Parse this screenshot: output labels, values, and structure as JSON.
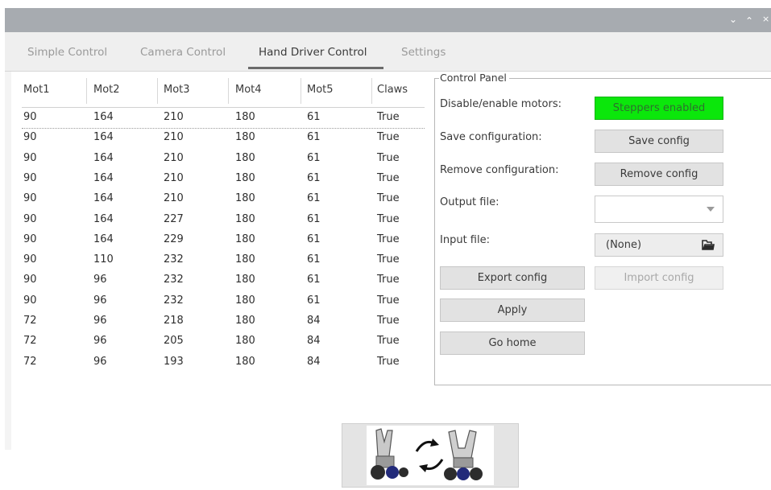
{
  "window": {
    "buttons": [
      "chevron-down-icon",
      "chevron-up-icon",
      "close-icon"
    ]
  },
  "tabs": [
    {
      "label": "Simple Control",
      "active": false
    },
    {
      "label": "Camera Control",
      "active": false
    },
    {
      "label": "Hand Driver Control",
      "active": true
    },
    {
      "label": "Settings",
      "active": false
    }
  ],
  "table": {
    "headers": [
      "Mot1",
      "Mot2",
      "Mot3",
      "Mot4",
      "Mot5",
      "Claws"
    ],
    "rows": [
      [
        "90",
        "164",
        "210",
        "180",
        "61",
        "True"
      ],
      [
        "90",
        "164",
        "210",
        "180",
        "61",
        "True"
      ],
      [
        "90",
        "164",
        "210",
        "180",
        "61",
        "True"
      ],
      [
        "90",
        "164",
        "210",
        "180",
        "61",
        "True"
      ],
      [
        "90",
        "164",
        "210",
        "180",
        "61",
        "True"
      ],
      [
        "90",
        "164",
        "227",
        "180",
        "61",
        "True"
      ],
      [
        "90",
        "164",
        "229",
        "180",
        "61",
        "True"
      ],
      [
        "90",
        "110",
        "232",
        "180",
        "61",
        "True"
      ],
      [
        "90",
        "96",
        "232",
        "180",
        "61",
        "True"
      ],
      [
        "90",
        "96",
        "232",
        "180",
        "61",
        "True"
      ],
      [
        "72",
        "96",
        "218",
        "180",
        "84",
        "True"
      ],
      [
        "72",
        "96",
        "205",
        "180",
        "84",
        "True"
      ],
      [
        "72",
        "96",
        "193",
        "180",
        "84",
        "True"
      ]
    ]
  },
  "panel": {
    "title": "Control Panel",
    "disable_enable_label": "Disable/enable motors:",
    "steppers_button": "Steppers enabled",
    "save_label": "Save configuration:",
    "save_button": "Save config",
    "remove_label": "Remove configuration:",
    "remove_button": "Remove config",
    "output_label": "Output file:",
    "output_value": "",
    "input_label": "Input file:",
    "input_value": "(None)",
    "export_button": "Export config",
    "import_button": "Import config",
    "apply_button": "Apply",
    "home_button": "Go home"
  },
  "colors": {
    "steppers_enabled": "#0be70b",
    "titlebar": "#a7abb0"
  }
}
